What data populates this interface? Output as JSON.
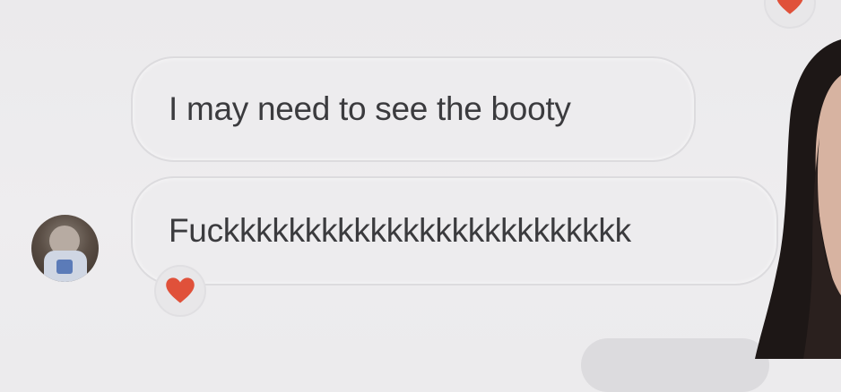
{
  "conversation": {
    "messages": [
      {
        "text": "I may need to see the booty"
      },
      {
        "text": "Fuckkkkkkkkkkkkkkkkkkkkkkkkk"
      }
    ]
  },
  "reactions": {
    "top": {
      "icon": "heart-icon",
      "color": "#e0513a"
    },
    "bottom": {
      "icon": "heart-icon",
      "color": "#e0513a"
    }
  },
  "colors": {
    "background": "#ecebed",
    "bubble": "#edecee",
    "bubble_border": "#dcdbde",
    "text": "#3b3b3e",
    "heart": "#e0513a"
  }
}
